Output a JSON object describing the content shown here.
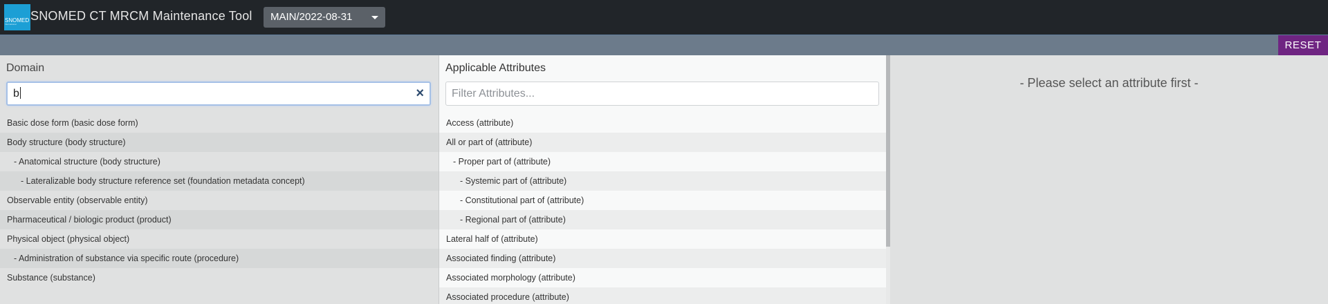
{
  "header": {
    "logo_text": "SNOMED",
    "logo_subtext": "International",
    "app_title": "SNOMED CT MRCM Maintenance Tool",
    "branch": "MAIN/2022-08-31"
  },
  "toolbar": {
    "reset_label": "RESET"
  },
  "domain": {
    "title": "Domain",
    "search_value": "b",
    "clear_icon": "×",
    "items": [
      {
        "label": "Basic dose form (basic dose form)",
        "level": 0
      },
      {
        "label": "Body structure (body structure)",
        "level": 0
      },
      {
        "label": "- Anatomical structure (body structure)",
        "level": 1
      },
      {
        "label": "- Lateralizable body structure reference set (foundation metadata concept)",
        "level": 2
      },
      {
        "label": "Observable entity (observable entity)",
        "level": 0
      },
      {
        "label": "Pharmaceutical / biologic product (product)",
        "level": 0
      },
      {
        "label": "Physical object (physical object)",
        "level": 0
      },
      {
        "label": "- Administration of substance via specific route (procedure)",
        "level": 1
      },
      {
        "label": "Substance (substance)",
        "level": 0
      }
    ]
  },
  "attributes": {
    "title": "Applicable Attributes",
    "filter_placeholder": "Filter Attributes...",
    "items": [
      {
        "label": "Access (attribute)",
        "level": 0
      },
      {
        "label": "All or part of (attribute)",
        "level": 0
      },
      {
        "label": "- Proper part of (attribute)",
        "level": 1
      },
      {
        "label": "- Systemic part of (attribute)",
        "level": 2
      },
      {
        "label": "- Constitutional part of (attribute)",
        "level": 2
      },
      {
        "label": "- Regional part of (attribute)",
        "level": 2
      },
      {
        "label": "Lateral half of (attribute)",
        "level": 0
      },
      {
        "label": "Associated finding (attribute)",
        "level": 0
      },
      {
        "label": "Associated morphology (attribute)",
        "level": 0
      },
      {
        "label": "Associated procedure (attribute)",
        "level": 0
      }
    ]
  },
  "range": {
    "message": "- Please select an attribute first -"
  }
}
